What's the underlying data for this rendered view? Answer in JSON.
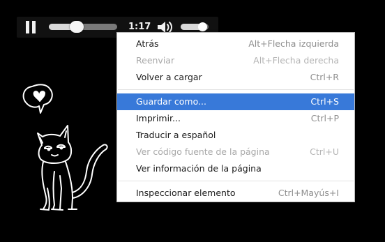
{
  "player": {
    "time": "1:17",
    "progress": 0.41,
    "volume": 0.8,
    "icons": {
      "play_state": "pause-icon",
      "volume": "volume-icon"
    }
  },
  "doodles": {
    "speech_bubble": "heart-speech-bubble-icon",
    "cat": "cat-doodle"
  },
  "context_menu": {
    "items": [
      {
        "label": "Atrás",
        "shortcut": "Alt+Flecha izquierda",
        "disabled": false
      },
      {
        "label": "Reenviar",
        "shortcut": "Alt+Flecha derecha",
        "disabled": true
      },
      {
        "label": "Volver a cargar",
        "shortcut": "Ctrl+R",
        "disabled": false
      },
      {
        "label": "Guardar como...",
        "shortcut": "Ctrl+S",
        "selected": true
      },
      {
        "label": "Imprimir...",
        "shortcut": "Ctrl+P",
        "disabled": false
      },
      {
        "label": "Traducir a español",
        "shortcut": "",
        "disabled": false
      },
      {
        "label": "Ver código fuente de la página",
        "shortcut": "Ctrl+U",
        "disabled": true
      },
      {
        "label": "Ver información de la página",
        "shortcut": "",
        "disabled": false
      },
      {
        "label": "Inspeccionar elemento",
        "shortcut": "Ctrl+Mayús+I",
        "disabled": false
      }
    ]
  },
  "colors": {
    "background": "#000000",
    "menu_highlight": "#3879d9",
    "menu_text": "#1a1a1a",
    "disabled_text": "#a8a8a8"
  }
}
